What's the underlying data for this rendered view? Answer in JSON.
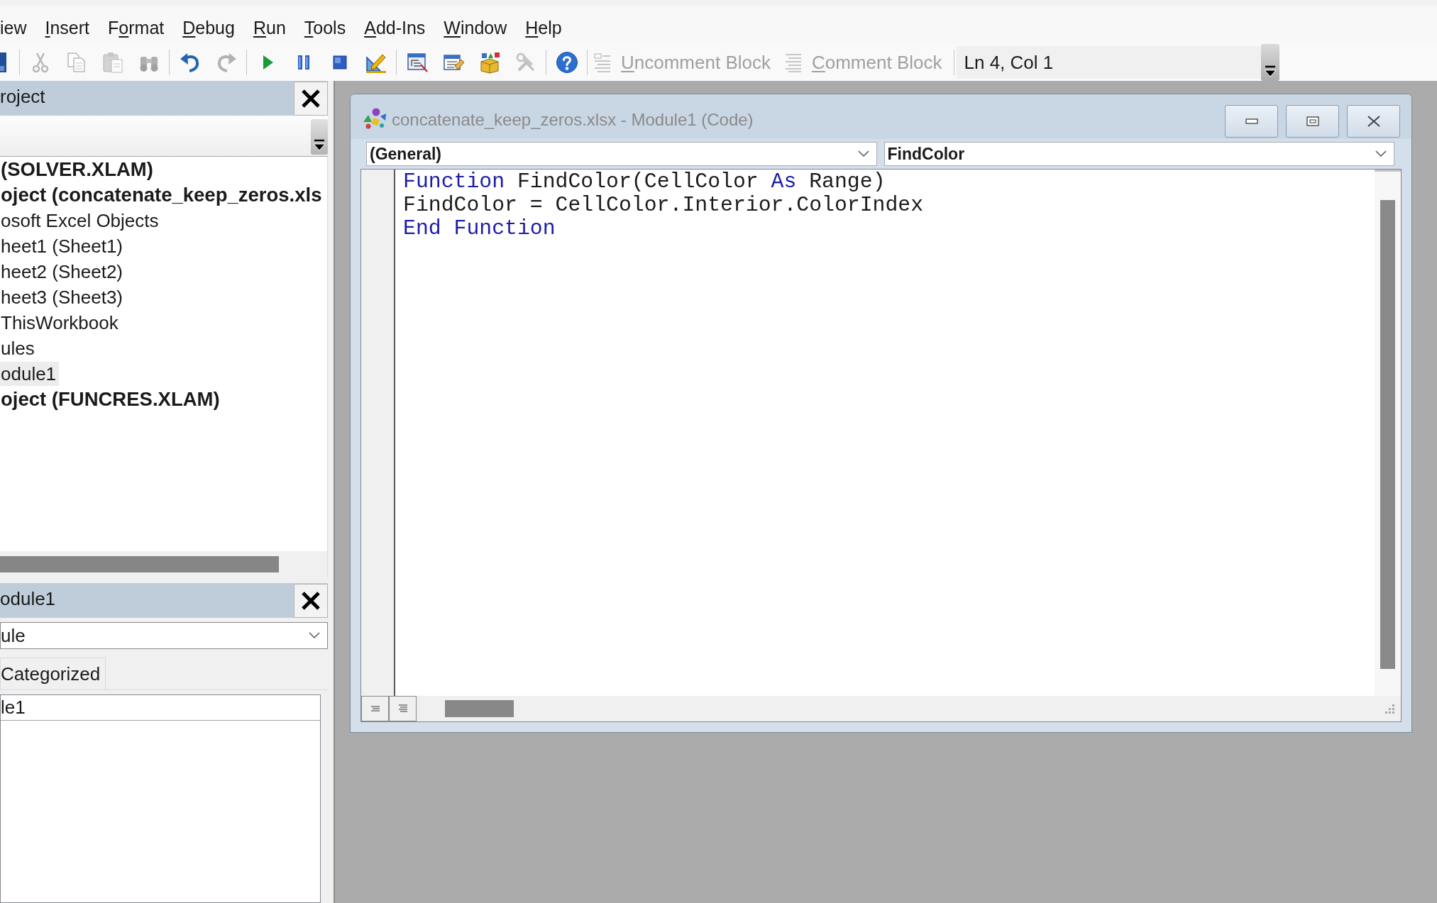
{
  "menu_bar": {
    "items": [
      {
        "text_before": "iew"
      },
      {
        "access_key": "I",
        "text_after": "nsert"
      },
      {
        "text_before": "F",
        "access_key": "o",
        "text_after": "rmat"
      },
      {
        "access_key": "D",
        "text_after": "ebug"
      },
      {
        "access_key": "R",
        "text_after": "un"
      },
      {
        "access_key": "T",
        "text_after": "ools"
      },
      {
        "access_key": "A",
        "text_after": "dd-Ins"
      },
      {
        "access_key": "W",
        "text_after": "indow"
      },
      {
        "access_key": "H",
        "text_after": "elp"
      }
    ]
  },
  "toolbar": {
    "items": [
      {
        "kind": "icon",
        "disabled": false
      },
      {
        "kind": "separator"
      },
      {
        "kind": "icon",
        "disabled": true
      },
      {
        "kind": "icon",
        "disabled": true
      },
      {
        "kind": "icon",
        "disabled": true
      },
      {
        "kind": "icon",
        "disabled": true
      },
      {
        "kind": "separator"
      },
      {
        "kind": "icon",
        "disabled": false
      },
      {
        "kind": "icon",
        "disabled": true
      },
      {
        "kind": "separator"
      },
      {
        "kind": "icon",
        "disabled": false
      },
      {
        "kind": "icon",
        "disabled": false
      },
      {
        "kind": "icon",
        "disabled": false
      },
      {
        "kind": "icon",
        "disabled": false
      },
      {
        "kind": "separator"
      },
      {
        "kind": "icon",
        "disabled": false
      },
      {
        "kind": "icon",
        "disabled": false
      },
      {
        "kind": "icon",
        "disabled": false
      },
      {
        "kind": "icon",
        "disabled": true
      },
      {
        "kind": "separator"
      },
      {
        "kind": "icon",
        "disabled": false
      },
      {
        "kind": "separator"
      },
      {
        "kind": "labelled",
        "disabled": true,
        "access_key": "U",
        "text_after": "ncomment Block"
      },
      {
        "kind": "labelled",
        "disabled": true,
        "access_key": "C",
        "text_after": "omment Block"
      },
      {
        "kind": "separator"
      },
      {
        "kind": "readout",
        "text": "Ln 4, Col 1"
      }
    ]
  },
  "project_panel": {
    "title": "roject",
    "tree": [
      {
        "label": "(SOLVER.XLAM)",
        "selected": false
      },
      {
        "label": "oject (concatenate_keep_zeros.xls",
        "selected": false,
        "children": [
          {
            "label": "osoft Excel Objects",
            "selected": false,
            "children": [
              {
                "label": "heet1 (Sheet1)",
                "selected": false
              },
              {
                "label": "heet2 (Sheet2)",
                "selected": false
              },
              {
                "label": "heet3 (Sheet3)",
                "selected": false
              },
              {
                "label": "ThisWorkbook",
                "selected": false
              }
            ]
          },
          {
            "label": "ules",
            "selected": false,
            "children": [
              {
                "label": "odule1",
                "selected": true
              }
            ]
          }
        ]
      },
      {
        "label": "oject (FUNCRES.XLAM)",
        "selected": false
      }
    ]
  },
  "properties_panel": {
    "title": "odule1",
    "object_selector": {
      "value": "ule"
    },
    "tabs": [
      {
        "label": "Categorized",
        "selected": false
      }
    ],
    "grid_rows": [
      {
        "value": "le1"
      }
    ]
  },
  "code_window": {
    "title": "concatenate_keep_zeros.xlsx - Module1 (Code)",
    "object_selector": {
      "value": "(General)"
    },
    "procedure_selector": {
      "value": "FindColor"
    },
    "code_lines": [
      {
        "tokens": [
          {
            "kind": "keyword",
            "text": "Function"
          },
          {
            "kind": "plain",
            "text": " FindColor(CellColor "
          },
          {
            "kind": "keyword",
            "text": "As"
          },
          {
            "kind": "plain",
            "text": " Range)"
          }
        ]
      },
      {
        "tokens": [
          {
            "kind": "plain",
            "text": "FindColor = CellColor.Interior.ColorIndex"
          }
        ]
      },
      {
        "tokens": [
          {
            "kind": "keyword",
            "text": "End Function"
          }
        ]
      }
    ]
  }
}
